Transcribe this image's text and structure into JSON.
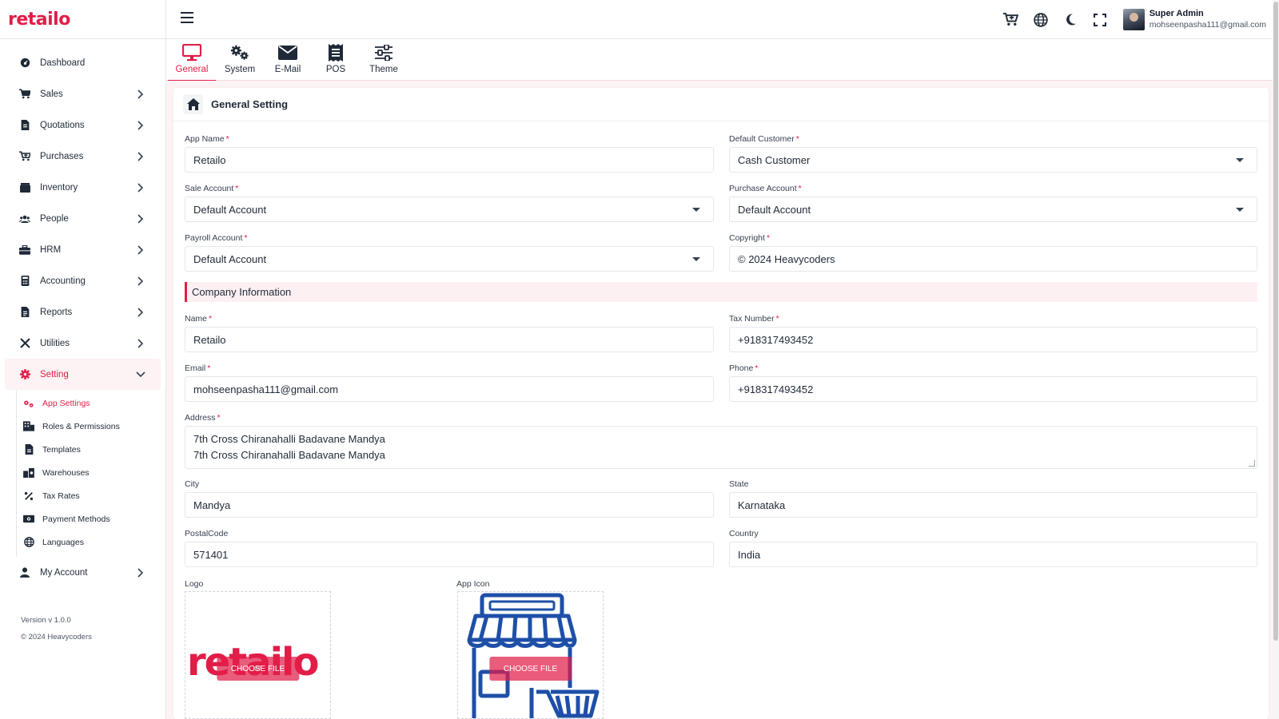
{
  "brand": {
    "logo_text": "retailo"
  },
  "colors": {
    "accent": "#e11d48",
    "accent_soft": "#fdf0f3",
    "text": "#1f2937",
    "border": "#e5e7eb"
  },
  "sidebar": {
    "items": [
      {
        "label": "Dashboard",
        "icon": "dashboard-icon",
        "has_children": false
      },
      {
        "label": "Sales",
        "icon": "cart-icon",
        "has_children": true
      },
      {
        "label": "Quotations",
        "icon": "document-icon",
        "has_children": true
      },
      {
        "label": "Purchases",
        "icon": "cart-plus-icon",
        "has_children": true
      },
      {
        "label": "Inventory",
        "icon": "box-icon",
        "has_children": true
      },
      {
        "label": "People",
        "icon": "users-icon",
        "has_children": true
      },
      {
        "label": "HRM",
        "icon": "briefcase-icon",
        "has_children": true
      },
      {
        "label": "Accounting",
        "icon": "calculator-icon",
        "has_children": true
      },
      {
        "label": "Reports",
        "icon": "report-icon",
        "has_children": true
      },
      {
        "label": "Utilities",
        "icon": "tools-icon",
        "has_children": true
      },
      {
        "label": "Setting",
        "icon": "gear-icon",
        "has_children": true,
        "expanded": true,
        "active": true
      }
    ],
    "setting_children": [
      {
        "label": "App Settings",
        "icon": "gears-icon",
        "active": true
      },
      {
        "label": "Roles & Permissions",
        "icon": "roles-icon"
      },
      {
        "label": "Templates",
        "icon": "template-icon"
      },
      {
        "label": "Warehouses",
        "icon": "warehouse-icon"
      },
      {
        "label": "Tax Rates",
        "icon": "percent-icon"
      },
      {
        "label": "Payment Methods",
        "icon": "money-icon"
      },
      {
        "label": "Languages",
        "icon": "globe-icon"
      }
    ],
    "my_account": {
      "label": "My Account",
      "icon": "user-icon"
    },
    "version": "Version v 1.0.0",
    "copyright": "© 2024 Heavycoders"
  },
  "topbar": {
    "icons": [
      "cart-icon",
      "globe-icon",
      "moon-icon",
      "fullscreen-icon"
    ],
    "user_name": "Super Admin",
    "user_email": "mohseenpasha111@gmail.com"
  },
  "tabs": [
    {
      "label": "General",
      "icon": "monitor-icon",
      "active": true
    },
    {
      "label": "System",
      "icon": "gears-icon"
    },
    {
      "label": "E-Mail",
      "icon": "envelope-icon"
    },
    {
      "label": "POS",
      "icon": "receipt-icon"
    },
    {
      "label": "Theme",
      "icon": "sliders-icon"
    }
  ],
  "panel": {
    "title": "General Setting"
  },
  "form": {
    "app_name": {
      "label": "App Name",
      "value": "Retailo"
    },
    "default_customer": {
      "label": "Default Customer",
      "value": "Cash Customer"
    },
    "sale_account": {
      "label": "Sale Account",
      "value": "Default Account"
    },
    "purchase_account": {
      "label": "Purchase Account",
      "value": "Default Account"
    },
    "payroll_account": {
      "label": "Payroll Account",
      "value": "Default Account"
    },
    "copyright": {
      "label": "Copyright",
      "value": "© 2024 Heavycoders"
    },
    "section_title": "Company Information",
    "name": {
      "label": "Name",
      "value": "Retailo"
    },
    "tax_number": {
      "label": "Tax Number",
      "value": "+918317493452"
    },
    "email": {
      "label": "Email",
      "value": "mohseenpasha111@gmail.com"
    },
    "phone": {
      "label": "Phone",
      "value": "+918317493452"
    },
    "address": {
      "label": "Address",
      "line1": "7th Cross Chiranahalli Badavane Mandya",
      "line2": "7th Cross Chiranahalli Badavane Mandya"
    },
    "city": {
      "label": "City",
      "value": "Mandya"
    },
    "state": {
      "label": "State",
      "value": "Karnataka"
    },
    "postal_code": {
      "label": "PostalCode",
      "value": "571401"
    },
    "country": {
      "label": "Country",
      "value": "India"
    },
    "logo": {
      "label": "Logo",
      "button": "CHOOSE FILE",
      "logo_text": "retailo"
    },
    "app_icon": {
      "label": "App Icon",
      "button": "CHOOSE FILE"
    },
    "required_mark": "*"
  }
}
